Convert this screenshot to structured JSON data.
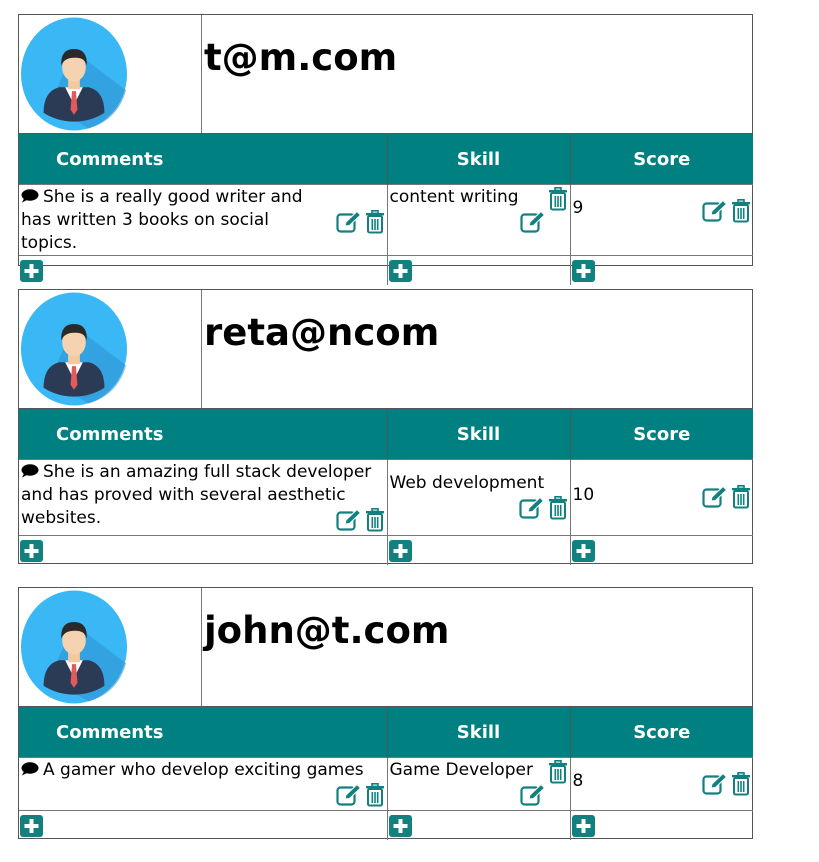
{
  "headers": {
    "comments": "Comments",
    "skill": "Skill",
    "score": "Score"
  },
  "colors": {
    "accent": "#008080",
    "avatar_bg": "#3AB8F5"
  },
  "icons": {
    "comment": "comment-icon",
    "edit": "edit-icon",
    "delete": "trash-icon",
    "add": "plus-square-icon",
    "avatar": "user-avatar-icon"
  },
  "cards": [
    {
      "email": "t@m.com",
      "comment": "She is a really good writer and has written 3 books on social topics.",
      "skill": "content writing",
      "score": "9"
    },
    {
      "email": "reta@ncom",
      "comment": "She is an amazing full stack developer and has proved with several aesthetic websites.",
      "skill": "Web development",
      "score": "10"
    },
    {
      "email": "john@t.com",
      "comment": "A gamer who develop exciting games",
      "skill": "Game Developer",
      "score": "8"
    }
  ]
}
